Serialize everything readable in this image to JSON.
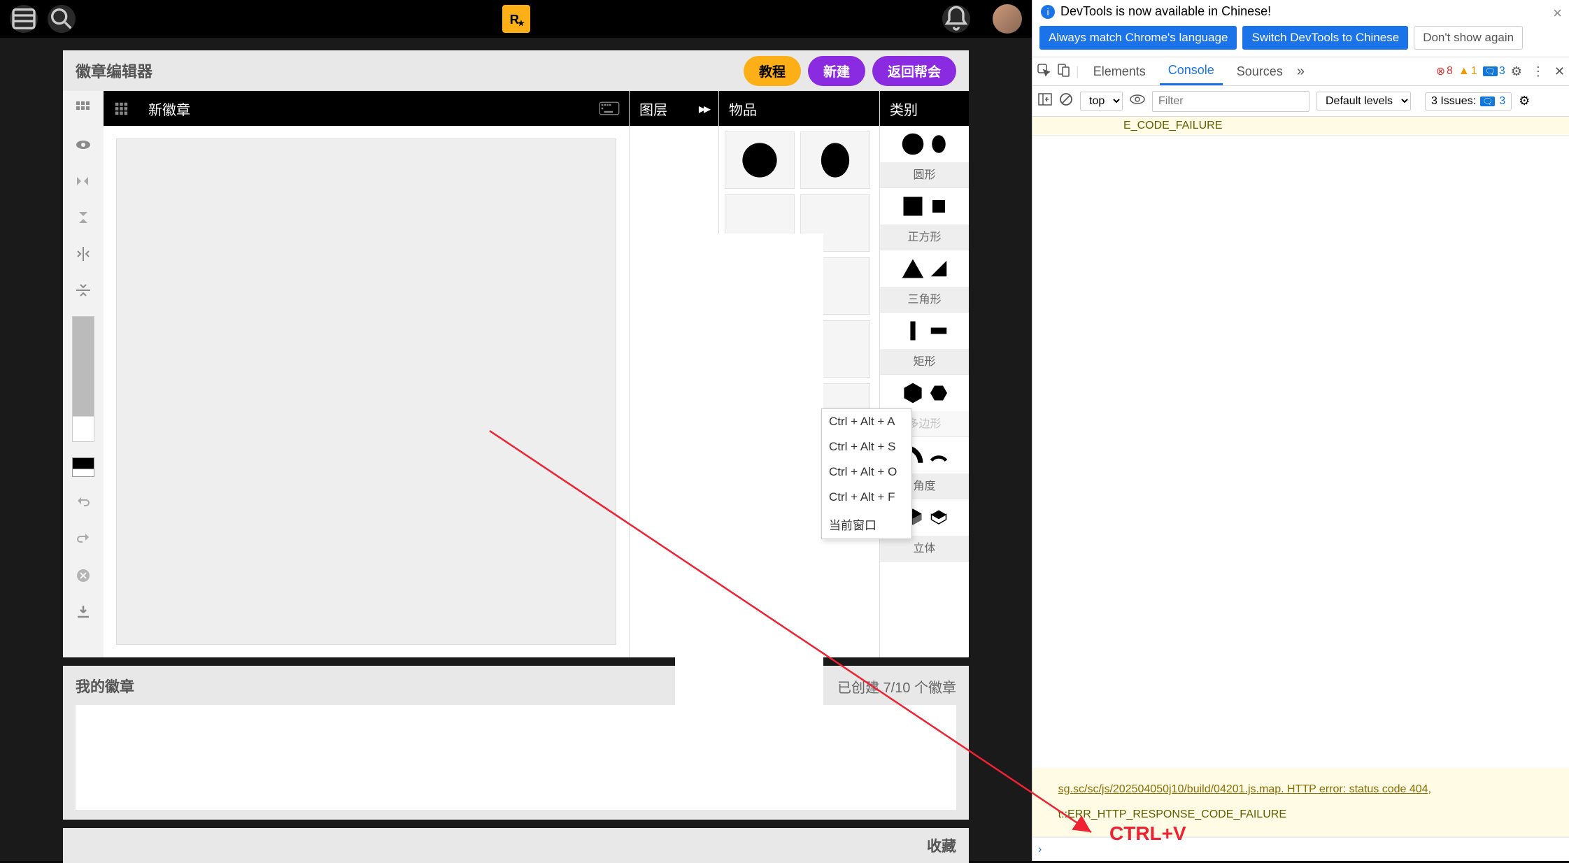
{
  "nav": {
    "logo_label": "R★"
  },
  "editor": {
    "title": "徽章编辑器",
    "btn_tutorial": "教程",
    "btn_new": "新建",
    "btn_return": "返回帮会",
    "canvas_title": "新徽章",
    "layers_label": "图层",
    "items_label": "物品",
    "categories_label": "类别"
  },
  "categories": [
    {
      "label": "圆形"
    },
    {
      "label": "正方形"
    },
    {
      "label": "三角形"
    },
    {
      "label": "矩形"
    },
    {
      "label": "多边形"
    },
    {
      "label": "角度"
    },
    {
      "label": "立体"
    }
  ],
  "context_menu": {
    "items": [
      "Ctrl + Alt + A",
      "Ctrl + Alt + S",
      "Ctrl + Alt + O",
      "Ctrl + Alt + F",
      "当前窗口"
    ]
  },
  "my_emblems": {
    "title": "我的徽章",
    "count_text": "已创建 7/10 个徽章"
  },
  "favorites": {
    "title": "收藏"
  },
  "devtools": {
    "banner_text": "DevTools is now available in Chinese!",
    "btn_match": "Always match Chrome's language",
    "btn_switch": "Switch DevTools to Chinese",
    "btn_dont": "Don't show again",
    "tabs": {
      "elements": "Elements",
      "console": "Console",
      "sources": "Sources"
    },
    "errors": "8",
    "warnings": "1",
    "infos": "3",
    "context": "top",
    "filter_ph": "Filter",
    "levels": "Default levels",
    "issues_label": "3 Issues:",
    "issues_count": "3",
    "msg_top": "E_CODE_FAILURE",
    "msg_bottom_1": "sg.sc/sc/js/202504050j10/build/04201.js.map. HTTP error: status code 404,",
    "msg_bottom_2": "t::ERR_HTTP_RESPONSE_CODE_FAILURE",
    "prompt": "›"
  },
  "annotation": {
    "text": "CTRL+V"
  }
}
